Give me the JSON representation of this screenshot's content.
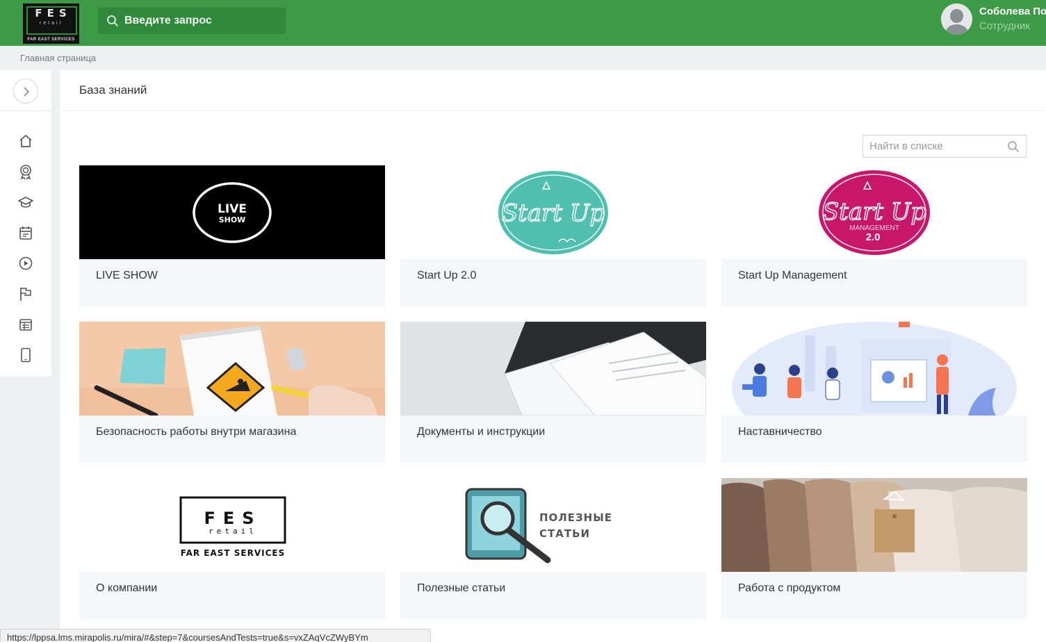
{
  "header": {
    "logo": {
      "fes": "FES",
      "retail": "retail",
      "sub": "FAR EAST SERVICES"
    },
    "search_placeholder": "Введите запрос",
    "user": {
      "name": "Соболева По",
      "role": "Сотрудник"
    }
  },
  "breadcrumb": "Главная страница",
  "sidebar": {
    "items": [
      {
        "icon": "home-icon"
      },
      {
        "icon": "award-icon"
      },
      {
        "icon": "graduation-cap-icon"
      },
      {
        "icon": "calendar-icon"
      },
      {
        "icon": "play-icon"
      },
      {
        "icon": "flag-icon"
      },
      {
        "icon": "table-icon"
      },
      {
        "icon": "mobile-icon"
      }
    ]
  },
  "main": {
    "title": "База знаний",
    "list_search_placeholder": "Найти в списке",
    "cards": [
      {
        "label": "LIVE SHOW",
        "thumb_text": [
          "LIVE",
          "SHOW"
        ]
      },
      {
        "label": "Start Up 2.0",
        "thumb_text": [
          "Start Up"
        ]
      },
      {
        "label": "Start Up Management",
        "thumb_text": [
          "Start Up",
          "MANAGEMENT",
          "2.0"
        ]
      },
      {
        "label": "Безопасность работы внутри магазина"
      },
      {
        "label": "Документы и инструкции"
      },
      {
        "label": "Наставничество"
      },
      {
        "label": "О компании",
        "thumb_text": [
          "FES",
          "retail",
          "FAR EAST SERVICES"
        ]
      },
      {
        "label": "Полезные статьи",
        "thumb_text": [
          "ПОЛЕЗНЫЕ",
          "СТАТЬИ"
        ]
      },
      {
        "label": "Работа с продуктом"
      }
    ]
  },
  "status_url": "https://lppsa.lms.mirapolis.ru/mira/#&step=7&coursesAndTests=true&s=vxZAqVcZWyBYm",
  "colors": {
    "header_green": "#3d9b47",
    "teal": "#4fbfb0",
    "magenta": "#c8176b"
  }
}
